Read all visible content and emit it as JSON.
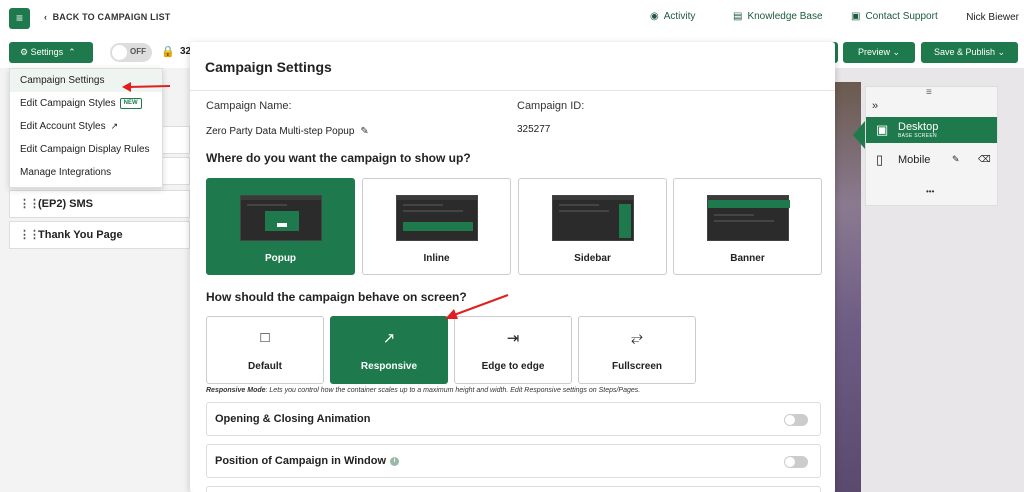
{
  "topbar": {
    "back_label": "BACK TO CAMPAIGN LIST",
    "activity": "Activity",
    "knowledge_base": "Knowledge Base",
    "contact_support": "Contact Support",
    "user_name": "Nick Biewer"
  },
  "toolbar": {
    "settings_label": "Settings",
    "toggle_label": "OFF",
    "campaign_id_peek": "32",
    "preview_label": "Preview",
    "save_publish_label": "Save & Publish"
  },
  "dropdown": {
    "items": [
      "Campaign Settings",
      "Edit Campaign Styles",
      "Edit Account Styles",
      "Edit Campaign Display Rules",
      "Manage Integrations"
    ],
    "new_badge": "NEW"
  },
  "steps": [
    "(EP2) SMS",
    "Thank You Page"
  ],
  "devices": {
    "desktop": "Desktop",
    "desktop_sub": "BASE SCREEN",
    "mobile": "Mobile",
    "more": "•••"
  },
  "modal": {
    "title": "Campaign Settings",
    "name_label": "Campaign Name:",
    "name_value": "Zero Party Data Multi-step Popup",
    "id_label": "Campaign ID:",
    "id_value": "325277",
    "where_question": "Where do you want the campaign to show up?",
    "types": [
      "Popup",
      "Inline",
      "Sidebar",
      "Banner"
    ],
    "selected_type": "Popup",
    "behave_question": "How should the campaign behave on screen?",
    "behaviors": [
      "Default",
      "Responsive",
      "Edge to edge",
      "Fullscreen"
    ],
    "selected_behavior": "Responsive",
    "note_title": "Responsive Mode",
    "note_text": ": Lets you control how the container scales up to a maximum height and width. Edit Responsive settings on Steps/Pages.",
    "rows": [
      "Opening & Closing Animation",
      "Position of Campaign in Window"
    ]
  },
  "colors": {
    "brand_green": "#1e7a4c",
    "arrow_red": "#e02020"
  }
}
